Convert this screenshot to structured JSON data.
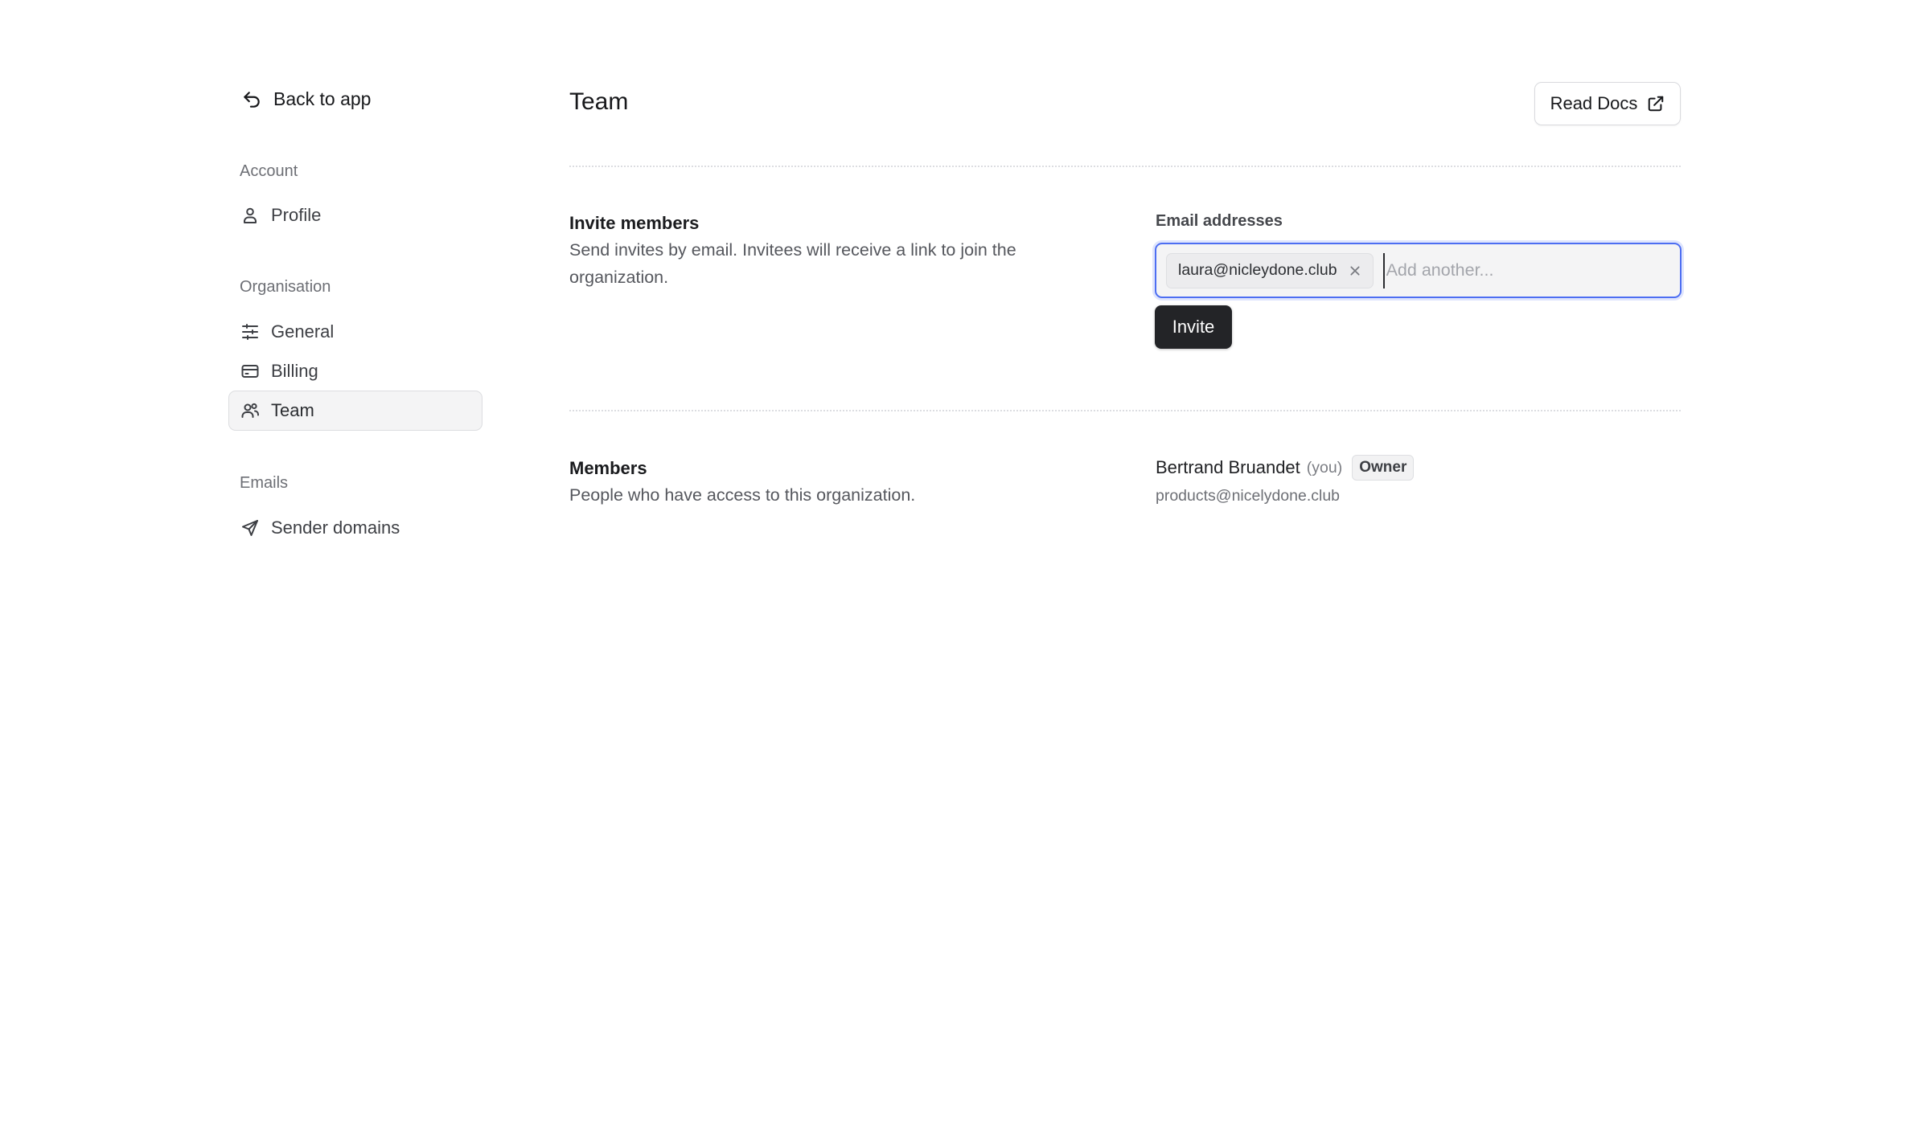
{
  "sidebar": {
    "back_label": "Back to app",
    "sections": [
      {
        "label": "Account",
        "items": [
          {
            "label": "Profile",
            "icon": "user-icon"
          }
        ]
      },
      {
        "label": "Organisation",
        "items": [
          {
            "label": "General",
            "icon": "sliders-icon"
          },
          {
            "label": "Billing",
            "icon": "credit-card-icon"
          },
          {
            "label": "Team",
            "icon": "users-icon",
            "active": true
          }
        ]
      },
      {
        "label": "Emails",
        "items": [
          {
            "label": "Sender domains",
            "icon": "send-icon"
          }
        ]
      }
    ]
  },
  "header": {
    "title": "Team",
    "docs_label": "Read Docs"
  },
  "invite": {
    "title": "Invite members",
    "description": "Send invites by email. Invitees will receive a link to join the organization.",
    "field_label": "Email addresses",
    "chips": [
      "laura@nicleydone.club"
    ],
    "input_placeholder": "Add another...",
    "button_label": "Invite"
  },
  "members": {
    "title": "Members",
    "description": "People who have access to this organization.",
    "list": [
      {
        "name": "Bertrand Bruandet",
        "you_label": "(you)",
        "role": "Owner",
        "email": "products@nicelydone.club"
      }
    ]
  },
  "colors": {
    "focus_ring": "#4d6ef2",
    "primary_button": "#232427",
    "active_nav_bg": "#f4f4f5"
  }
}
